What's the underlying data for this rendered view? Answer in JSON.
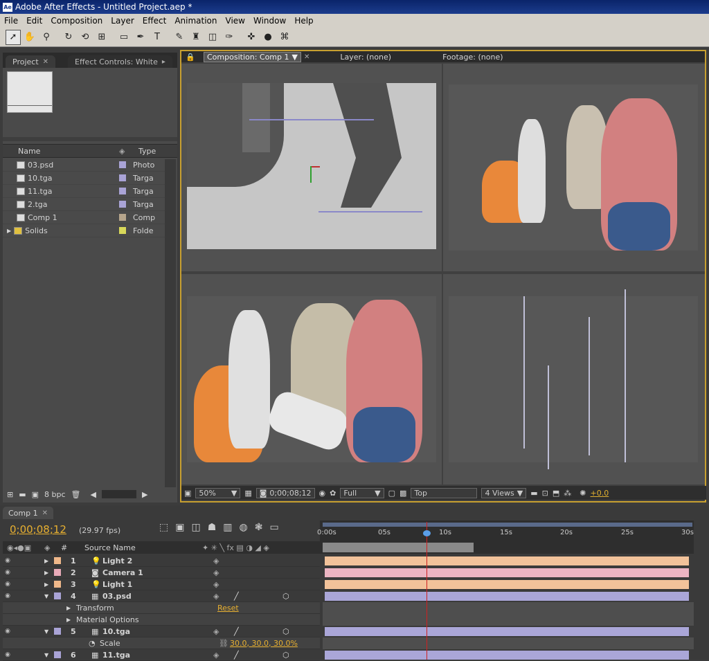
{
  "window": {
    "title": "Adobe After Effects - Untitled Project.aep *",
    "app_icon": "Ae"
  },
  "menu": [
    "File",
    "Edit",
    "Composition",
    "Layer",
    "Effect",
    "Animation",
    "View",
    "Window",
    "Help"
  ],
  "tools": [
    {
      "name": "selection-tool-icon",
      "glyph": "➚"
    },
    {
      "name": "hand-tool-icon",
      "glyph": "✋"
    },
    {
      "name": "zoom-tool-icon",
      "glyph": "⚲"
    },
    {
      "name": "rotate-tool-icon",
      "glyph": "↻"
    },
    {
      "name": "orbit-camera-icon",
      "glyph": "⟲"
    },
    {
      "name": "pan-behind-icon",
      "glyph": "⊞"
    },
    {
      "name": "rectangle-mask-icon",
      "glyph": "▭"
    },
    {
      "name": "pen-tool-icon",
      "glyph": "✒"
    },
    {
      "name": "text-tool-icon",
      "glyph": "T"
    },
    {
      "name": "brush-tool-icon",
      "glyph": "✎"
    },
    {
      "name": "clone-stamp-icon",
      "glyph": "♜"
    },
    {
      "name": "eraser-tool-icon",
      "glyph": "◫"
    },
    {
      "name": "puppet-pin-icon",
      "glyph": "✑"
    },
    {
      "name": "local-axis-icon",
      "glyph": "✜"
    },
    {
      "name": "world-axis-icon",
      "glyph": "●"
    },
    {
      "name": "view-axis-icon",
      "glyph": "⌘"
    }
  ],
  "project": {
    "tabs": [
      "Project",
      "Effect Controls: White"
    ],
    "columns": {
      "name": "Name",
      "type": "Type"
    },
    "items": [
      {
        "name": "03.psd",
        "type": "Photo",
        "color": "#a9a3d6"
      },
      {
        "name": "10.tga",
        "type": "Targa",
        "color": "#a9a3d6"
      },
      {
        "name": "11.tga",
        "type": "Targa",
        "color": "#a9a3d6"
      },
      {
        "name": "2.tga",
        "type": "Targa",
        "color": "#a9a3d6"
      },
      {
        "name": "Comp 1",
        "type": "Comp",
        "color": "#b6a58c"
      },
      {
        "name": "Solids",
        "type": "Folde",
        "color": "#d8d85a"
      }
    ],
    "footer_bpc": "8 bpc"
  },
  "viewer": {
    "tabs": [
      "Composition: Comp 1",
      "Layer: (none)",
      "Footage: (none)"
    ],
    "zoom": "50%",
    "timecode": "0;00;08;12",
    "resolution": "Full",
    "view": "Top",
    "layout": "4 Views",
    "exposure": "+0.0"
  },
  "timeline": {
    "tab": "Comp 1",
    "current_time": "0;00;08;12",
    "fps": "(29.97 fps)",
    "columns": {
      "num": "#",
      "source": "Source Name"
    },
    "ruler": [
      "0:00s",
      "05s",
      "10s",
      "15s",
      "20s",
      "25s",
      "30s"
    ],
    "layers": [
      {
        "num": "1",
        "name": "Light 2",
        "color": "#f0b88a",
        "kind": "light",
        "bar": "#f2c29a"
      },
      {
        "num": "2",
        "name": "Camera 1",
        "color": "#e8aab8",
        "kind": "camera",
        "bar": "#ecb4c2"
      },
      {
        "num": "3",
        "name": "Light 1",
        "color": "#f0b88a",
        "kind": "light",
        "bar": "#f2c29a"
      },
      {
        "num": "4",
        "name": "03.psd",
        "color": "#a9a3d6",
        "kind": "footage",
        "bar": "#aaa6d8"
      },
      {
        "num": "5",
        "name": "10.tga",
        "color": "#a9a3d6",
        "kind": "footage",
        "bar": "#aaa6d8"
      },
      {
        "num": "6",
        "name": "11.tga",
        "color": "#a9a3d6",
        "kind": "footage",
        "bar": "#aaa6d8"
      }
    ],
    "props": {
      "transform": "Transform",
      "transform_value": "Reset",
      "material": "Material Options",
      "scale": "Scale",
      "scale_value": "30.0, 30.0, 30.0%"
    }
  }
}
